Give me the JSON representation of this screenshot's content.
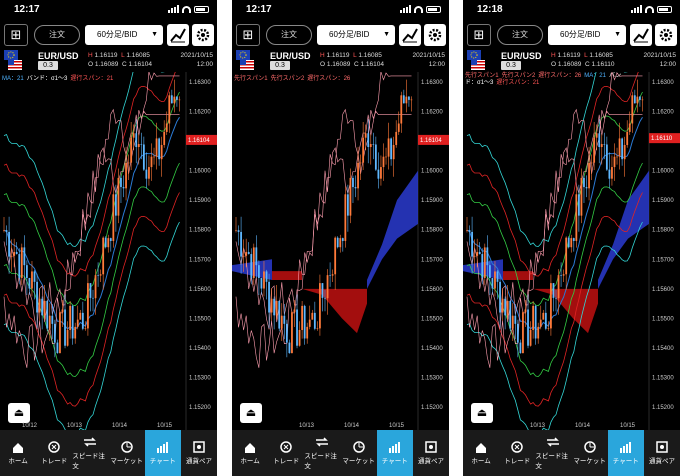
{
  "colors": {
    "accent": "#2aa6dc",
    "red_price": "#e02020",
    "cloud_blue": "#2233cc",
    "cloud_red": "#c01010"
  },
  "screens": [
    {
      "time": "12:17",
      "symbol": "EUR/USD",
      "spread": "0.3",
      "order_label": "注文",
      "timeframe": "60分足/BID",
      "H": "H",
      "H_val": "1.16119",
      "L": "L",
      "L_val": "1.16085",
      "O": "O",
      "O_val": "1.16089",
      "C": "C",
      "C_val": "1.16104",
      "date": "2021/10/15",
      "clock": "12:00",
      "legend": [
        {
          "text": "MA：21",
          "color": "#4fb3ff"
        },
        {
          "text": "バンド：σ1〜3",
          "color": "#ffffff"
        },
        {
          "text": "遅行スパン：21",
          "color": "#ff5555"
        }
      ],
      "price_tag": "1.16104",
      "x_labels": [
        "10/12",
        "10/13",
        "10/14",
        "10/15"
      ]
    },
    {
      "time": "12:17",
      "symbol": "EUR/USD",
      "spread": "0.3",
      "order_label": "注文",
      "timeframe": "60分足/BID",
      "H": "H",
      "H_val": "1.16119",
      "L": "L",
      "L_val": "1.16085",
      "O": "O",
      "O_val": "1.16089",
      "C": "C",
      "C_val": "1.16104",
      "date": "2021/10/15",
      "clock": "12:00",
      "legend": [
        {
          "text": "先行スパン1",
          "color": "#ff6b6b"
        },
        {
          "text": "先行スパン2",
          "color": "#ff6b6b"
        },
        {
          "text": "遅行スパン：26",
          "color": "#ff6b6b"
        }
      ],
      "price_tag": "1.16104",
      "x_labels": [
        "10/13",
        "10/14",
        "10/15"
      ]
    },
    {
      "time": "12:18",
      "symbol": "EUR/USD",
      "spread": "0.3",
      "order_label": "注文",
      "timeframe": "60分足/BID",
      "H": "H",
      "H_val": "1.16119",
      "L": "L",
      "L_val": "1.16085",
      "O": "O",
      "O_val": "1.16089",
      "C": "C",
      "C_val": "1.16110",
      "date": "2021/10/15",
      "clock": "12:00",
      "legend": [
        {
          "text": "先行スパン1",
          "color": "#ff6b6b"
        },
        {
          "text": "先行スパン2",
          "color": "#ff6b6b"
        },
        {
          "text": "遅行スパン：26",
          "color": "#ff6b6b"
        },
        {
          "text": "MA：21",
          "color": "#4fb3ff"
        },
        {
          "text": "バンド：σ1〜3",
          "color": "#ffffff"
        },
        {
          "text": "遅行スパン：21",
          "color": "#ff5555"
        }
      ],
      "price_tag": "1.16110",
      "x_labels": [
        "10/13",
        "10/14",
        "10/15"
      ]
    }
  ],
  "y_axis": [
    "1.16300",
    "1.16200",
    "1.16100",
    "1.16000",
    "1.15900",
    "1.15800",
    "1.15700",
    "1.15600",
    "1.15500",
    "1.15400",
    "1.15300",
    "1.15200"
  ],
  "tabs": [
    {
      "label": "ホーム",
      "icon": "home-icon"
    },
    {
      "label": "トレード",
      "icon": "trade-icon"
    },
    {
      "label": "スピード注文",
      "icon": "speed-order-icon"
    },
    {
      "label": "マーケット",
      "icon": "market-icon"
    },
    {
      "label": "チャート",
      "icon": "chart-icon",
      "active": true
    },
    {
      "label": "通貨ペア",
      "icon": "currency-pair-icon"
    }
  ]
}
